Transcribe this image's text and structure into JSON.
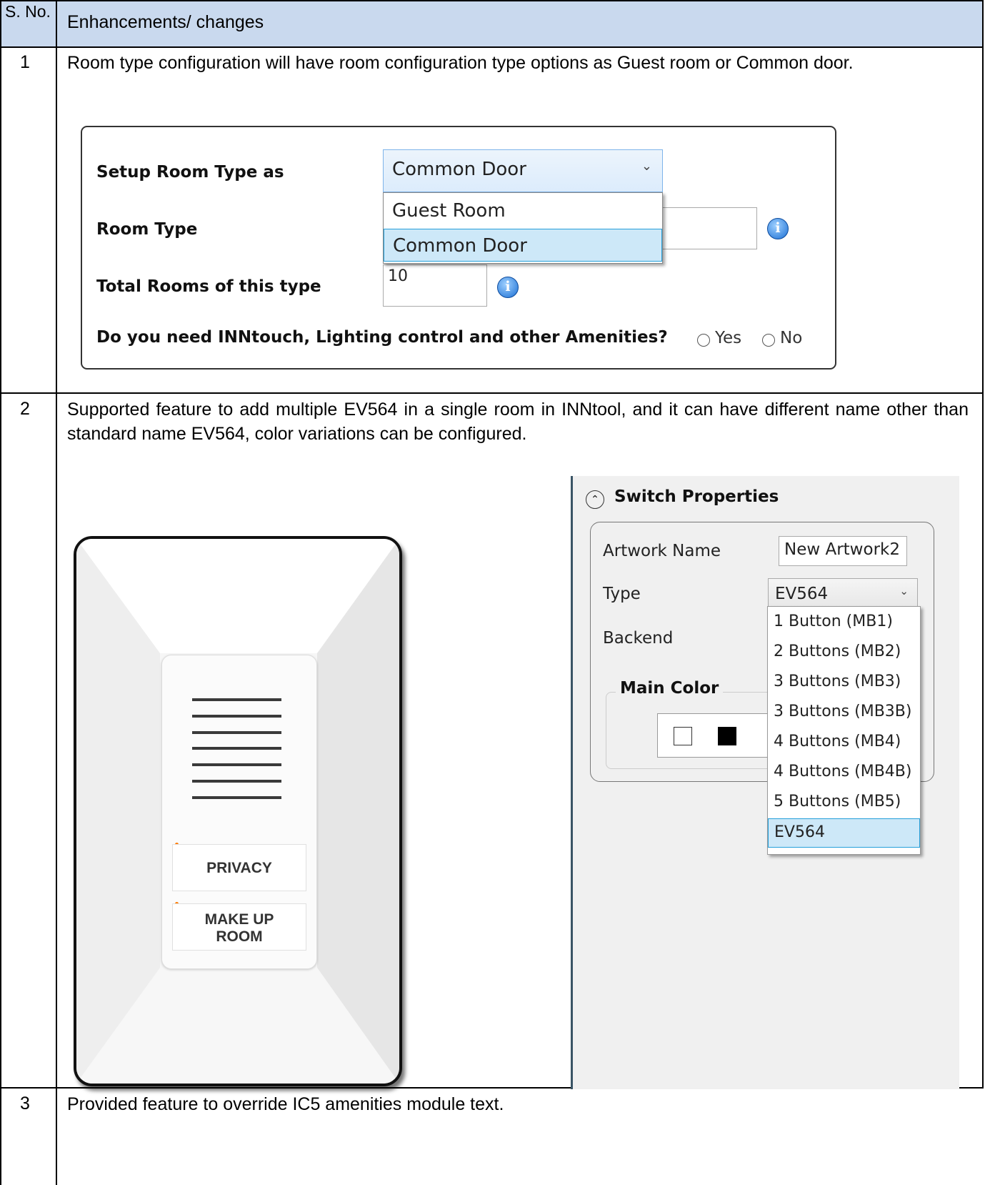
{
  "table": {
    "header": {
      "sno": "S. No.",
      "changes": "Enhancements/ changes"
    },
    "rows": [
      {
        "sno": "1",
        "text": "Room type configuration will have room configuration type options as Guest room or Common door."
      },
      {
        "sno": "2",
        "text": "Supported feature to add multiple EV564 in a single room in INNtool, and it can have different name other than standard name EV564, color variations can be configured."
      },
      {
        "sno": "3",
        "text": "Provided feature to override IC5 amenities module text."
      }
    ]
  },
  "room_config": {
    "setup_label": "Setup Room Type as",
    "setup_value": "Common Door",
    "options": [
      "Guest Room",
      "Common Door"
    ],
    "selected_option": "Common Door",
    "room_type_label": "Room Type",
    "total_label": "Total Rooms of this type",
    "total_value": "10",
    "info_glyph": "i",
    "question": "Do you need INNtouch, Lighting control and other Amenities?",
    "yes_label": "Yes",
    "no_label": "No",
    "chevron": "⌄"
  },
  "device": {
    "button1": "PRIVACY",
    "button2_line1": "MAKE UP",
    "button2_line2": "ROOM",
    "led_color": "#ff7a00"
  },
  "switch_properties": {
    "title": "Switch Properties",
    "collapse_glyph": "⌃",
    "artwork_label": "Artwork Name",
    "artwork_value": "New Artwork2",
    "type_label": "Type",
    "type_value": "EV564",
    "backend_label": "Backend",
    "main_color_label": "Main Color",
    "type_options": [
      "1 Button (MB1)",
      "2 Buttons (MB2)",
      "3 Buttons (MB3)",
      "3 Buttons (MB3B)",
      "4 Buttons (MB4)",
      "4 Buttons (MB4B)",
      "5 Buttons (MB5)",
      "EV564"
    ],
    "selected_option": "EV564"
  },
  "colors": {
    "header_bg": "#c9d9ee",
    "selection_bg": "#cde8f8",
    "selection_border": "#26a0da"
  }
}
